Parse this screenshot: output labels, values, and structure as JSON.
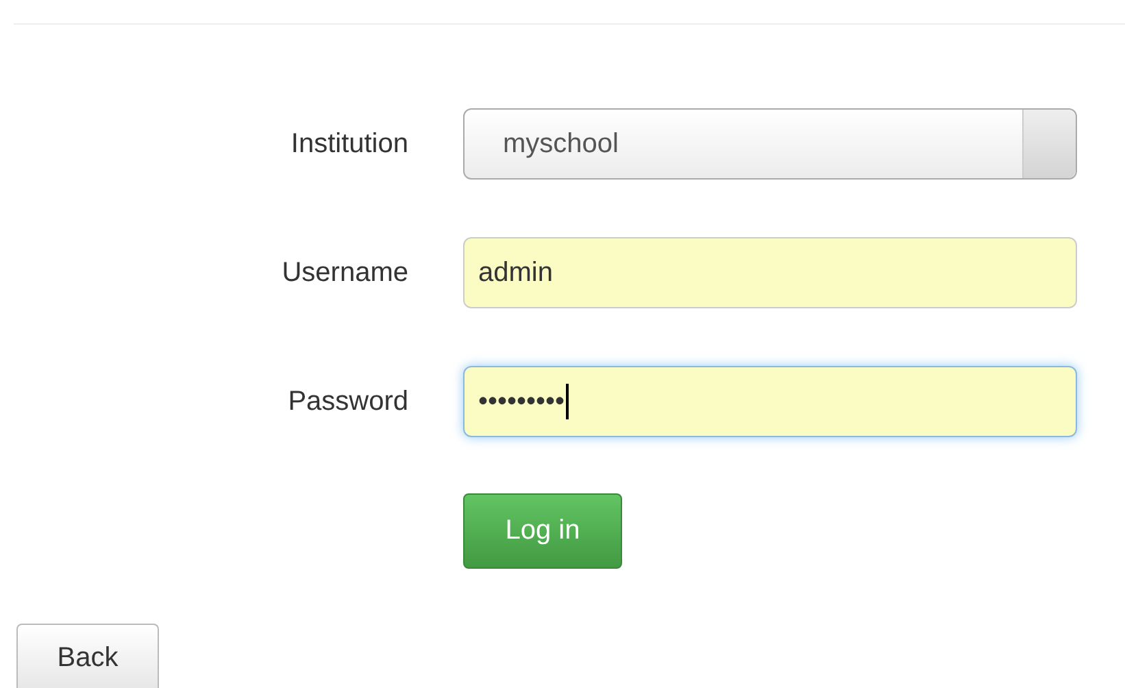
{
  "fields": [
    {
      "label": "Institution",
      "kind": "select",
      "value": "myschool",
      "focused": false
    },
    {
      "label": "Username",
      "kind": "text",
      "value": "admin",
      "focused": false
    },
    {
      "label": "Password",
      "kind": "password",
      "value": "•••••••••",
      "focused": true
    }
  ],
  "submit_button": "Log in",
  "back_button": "Back"
}
